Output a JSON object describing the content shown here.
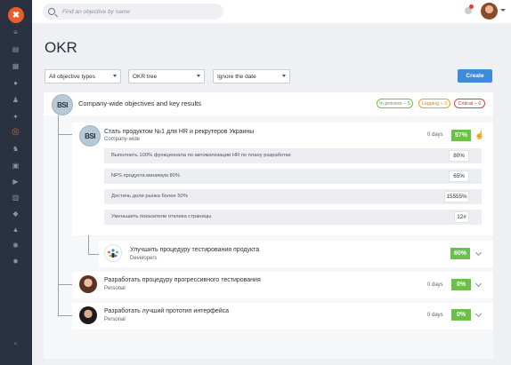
{
  "header": {
    "search_placeholder": "Find an objective by name"
  },
  "page": {
    "title": "OKR"
  },
  "filters": {
    "types": "All objective types",
    "view": "OKR tree",
    "date": "Ignore the date",
    "create_label": "Create"
  },
  "root": {
    "avatar_text": "BSI",
    "title": "Company-wide objectives and key results",
    "badges": [
      {
        "label": "In process – 5",
        "color": "#6cc04a"
      },
      {
        "label": "Lagging – 0",
        "color": "#f0a020"
      },
      {
        "label": "Critical – 0",
        "color": "#e2403a"
      }
    ]
  },
  "objectives": [
    {
      "title": "Стать продуктом №1 для HR и рекрутеров Украины",
      "owner": "Company-wide",
      "days": "0 days",
      "progress": "57%",
      "key_results": [
        {
          "text": "Выполнить 100% функционала по автоматизации HR по плану разработки",
          "value": "80%"
        },
        {
          "text": "NPS продукта минимум 80%",
          "value": "65%"
        },
        {
          "text": "Достичь доли рынка более 50%",
          "value": "15555%"
        },
        {
          "text": "Уменьшить показатели отклика страницы",
          "value": "12#"
        }
      ]
    },
    {
      "title": "Улучшить процедуру тестирования продукта",
      "owner": "Developers",
      "days": "",
      "progress": "60%"
    },
    {
      "title": "Разработать процедуру прогрессивного тестирования",
      "owner": "Personal",
      "days": "0 days",
      "progress": "0%"
    },
    {
      "title": "Разработать лучший прототип интерфейса",
      "owner": "Personal",
      "days": "0 days",
      "progress": "0%"
    }
  ],
  "icons": [
    "app-logo-icon",
    "search-icon",
    "bell-icon",
    "chevron-down-icon",
    "target-icon",
    "cursor-icon"
  ],
  "colors": {
    "accent": "#ec5b2c",
    "primary": "#3d8bd9",
    "success": "#6cc04a",
    "sidebar": "#2a3140"
  }
}
